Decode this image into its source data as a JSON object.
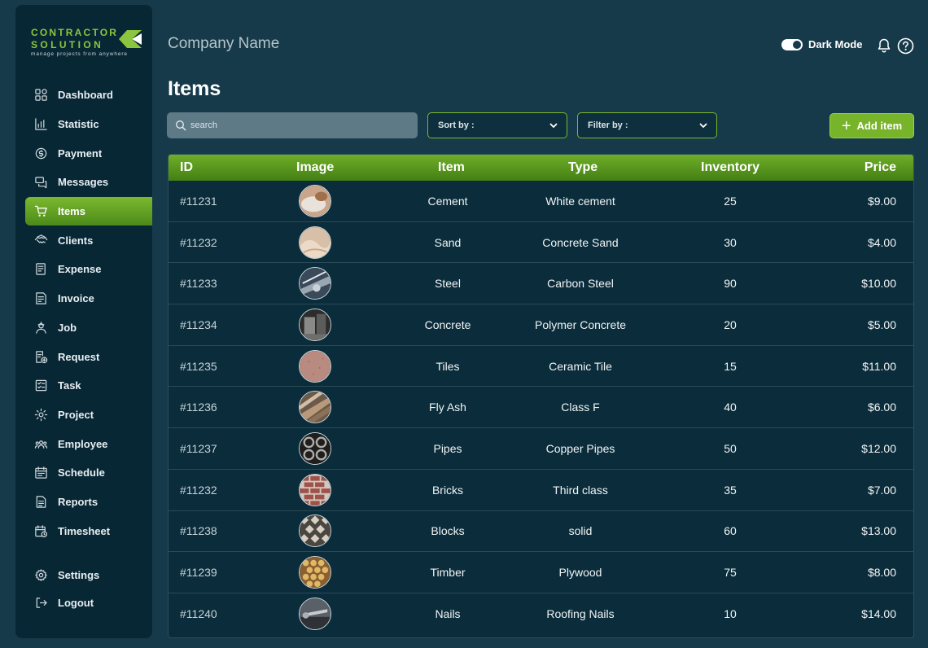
{
  "brand": {
    "line1": "CONTRACTOR",
    "line2": "SOLUTION",
    "tagline": "manage projects from anywhere",
    "accent": "#8cc63e"
  },
  "header": {
    "company": "Company Name",
    "dark_mode_label": "Dark Mode",
    "dark_mode_on": true
  },
  "page_title": "Items",
  "sidebar": {
    "items": [
      {
        "label": "Dashboard",
        "icon": "dashboard-icon"
      },
      {
        "label": "Statistic",
        "icon": "chart-icon"
      },
      {
        "label": "Payment",
        "icon": "payment-icon"
      },
      {
        "label": "Messages",
        "icon": "messages-icon"
      },
      {
        "label": "Items",
        "icon": "cart-icon",
        "active": true
      },
      {
        "label": "Clients",
        "icon": "handshake-icon"
      },
      {
        "label": "Expense",
        "icon": "expense-icon"
      },
      {
        "label": "Invoice",
        "icon": "invoice-icon"
      },
      {
        "label": "Job",
        "icon": "worker-icon"
      },
      {
        "label": "Request",
        "icon": "request-icon"
      },
      {
        "label": "Task",
        "icon": "task-icon"
      },
      {
        "label": "Project",
        "icon": "project-icon"
      },
      {
        "label": "Employee",
        "icon": "team-icon"
      },
      {
        "label": "Schedule",
        "icon": "calendar-icon"
      },
      {
        "label": "Reports",
        "icon": "report-icon"
      },
      {
        "label": "Timesheet",
        "icon": "timesheet-icon"
      }
    ],
    "bottom": [
      {
        "label": "Settings",
        "icon": "gear-icon"
      },
      {
        "label": "Logout",
        "icon": "logout-icon"
      }
    ]
  },
  "controls": {
    "search_placeholder": "search",
    "sort_label": "Sort by :",
    "filter_label": "Filter by :",
    "add_label": "Add item"
  },
  "table": {
    "columns": [
      "ID",
      "Image",
      "Item",
      "Type",
      "Inventory",
      "Price"
    ],
    "rows": [
      {
        "id": "#11231",
        "item": "Cement",
        "type": "White cement",
        "inventory": "25",
        "price": "$9.00",
        "thumb": "cement"
      },
      {
        "id": "#11232",
        "item": "Sand",
        "type": "Concrete Sand",
        "inventory": "30",
        "price": "$4.00",
        "thumb": "sand"
      },
      {
        "id": "#11233",
        "item": "Steel",
        "type": "Carbon Steel",
        "inventory": "90",
        "price": "$10.00",
        "thumb": "steel"
      },
      {
        "id": "#11234",
        "item": "Concrete",
        "type": "Polymer Concrete",
        "inventory": "20",
        "price": "$5.00",
        "thumb": "concrete"
      },
      {
        "id": "#11235",
        "item": "Tiles",
        "type": "Ceramic Tile",
        "inventory": "15",
        "price": "$11.00",
        "thumb": "tiles"
      },
      {
        "id": "#11236",
        "item": "Fly Ash",
        "type": "Class F",
        "inventory": "40",
        "price": "$6.00",
        "thumb": "flyash"
      },
      {
        "id": "#11237",
        "item": "Pipes",
        "type": "Copper Pipes",
        "inventory": "50",
        "price": "$12.00",
        "thumb": "pipes"
      },
      {
        "id": "#11232",
        "item": "Bricks",
        "type": "Third class",
        "inventory": "35",
        "price": "$7.00",
        "thumb": "bricks"
      },
      {
        "id": "#11238",
        "item": "Blocks",
        "type": "solid",
        "inventory": "60",
        "price": "$13.00",
        "thumb": "blocks"
      },
      {
        "id": "#11239",
        "item": "Timber",
        "type": "Plywood",
        "inventory": "75",
        "price": "$8.00",
        "thumb": "timber"
      },
      {
        "id": "#11240",
        "item": "Nails",
        "type": "Roofing Nails",
        "inventory": "10",
        "price": "$14.00",
        "thumb": "nails"
      }
    ]
  }
}
